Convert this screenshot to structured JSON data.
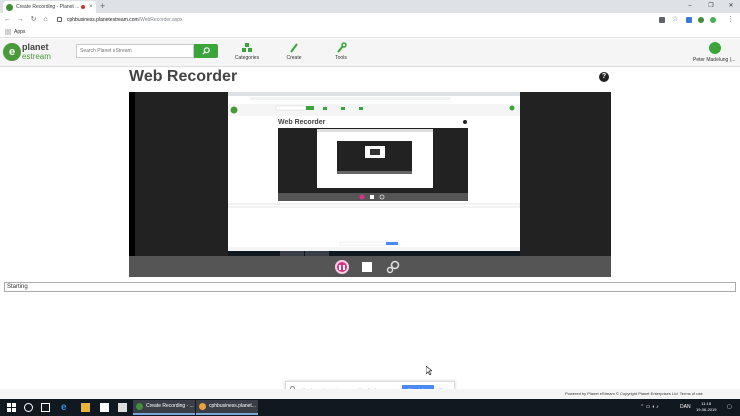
{
  "browser": {
    "tab_title": "Create Recording - Planet ...",
    "url_host": "cphbusiness.planetestream.com",
    "url_path": "/WebRecorder.aspx",
    "bookmarks_apps_label": "Apps",
    "accent": "#3f8f3a"
  },
  "header": {
    "logo_line1": "planet",
    "logo_line2": "estream",
    "search_placeholder": "Search Planet eStream",
    "nav": [
      {
        "label": "Categories",
        "icon": "categories-icon"
      },
      {
        "label": "Create",
        "icon": "pencil-icon"
      },
      {
        "label": "Tools",
        "icon": "wrench-icon"
      }
    ],
    "user_name": "Peter Madelung (..."
  },
  "page": {
    "title": "Web Recorder",
    "status": "Starting"
  },
  "recorder": {
    "preview_title": "Web Recorder",
    "pause_color": "#d63384"
  },
  "share_bar": {
    "text": "cphbusiness.planetestream.com deler din skærm.",
    "stop_label": "Stop deling",
    "hide_label": "Skjul"
  },
  "footer": {
    "text": "Powered by Planet eStream © Copyright Planet Enterprises Ltd",
    "terms": "Terms of use"
  },
  "taskbar": {
    "apps": [
      {
        "label": "Create Recording - ...",
        "color": "#3f8f3a"
      },
      {
        "label": "cphbusiness.planet...",
        "color": "#e8a33a"
      }
    ],
    "lang": "DAN",
    "time": "11:18",
    "date": "19-06-2019"
  }
}
